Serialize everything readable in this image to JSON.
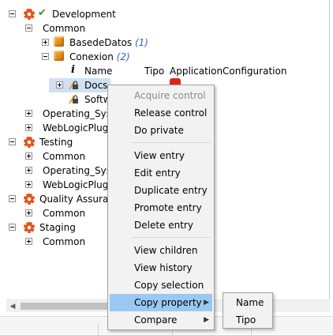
{
  "tree": {
    "development": {
      "label": "Development",
      "check": "✔"
    },
    "development_common": {
      "label": "Common"
    },
    "basededatos": {
      "label": "BasedeDatos",
      "count": "(1)"
    },
    "conexion": {
      "label": "Conexion",
      "count": "(2)"
    },
    "column_name": "Name",
    "column_tipo": "Tipo",
    "column_appconfig": "ApplicationConfiguration",
    "docs": {
      "label": "Docs"
    },
    "softw": {
      "label": "Softw"
    },
    "dev_operating": {
      "label": "Operating_Syste"
    },
    "dev_weblogic": {
      "label": "WebLogicPlugin"
    },
    "testing": {
      "label": "Testing"
    },
    "testing_common": {
      "label": "Common"
    },
    "testing_operating": {
      "label": "Operating_Syste"
    },
    "testing_weblogic": {
      "label": "WebLogicPlugin"
    },
    "qa": {
      "label": "Quality Assuranc"
    },
    "qa_common": {
      "label": "Common"
    },
    "staging": {
      "label": "Staging"
    },
    "staging_common": {
      "label": "Common"
    }
  },
  "context_menu": {
    "acquire_control": "Acquire control",
    "release_control": "Release control",
    "do_private": "Do private",
    "view_entry": "View entry",
    "edit_entry": "Edit entry",
    "duplicate_entry": "Duplicate entry",
    "promote_entry": "Promote entry",
    "delete_entry": "Delete entry",
    "view_children": "View children",
    "view_history": "View history",
    "copy_selection": "Copy selection",
    "copy_property": "Copy property",
    "compare": "Compare"
  },
  "submenu": {
    "name": "Name",
    "tipo": "Tipo"
  },
  "colors": {
    "selection": "#cfe1f3",
    "menu_hover": "#99c9f2",
    "count_text": "#3a5fc8",
    "gear": "#e2541b",
    "check": "#2e9b1f"
  }
}
